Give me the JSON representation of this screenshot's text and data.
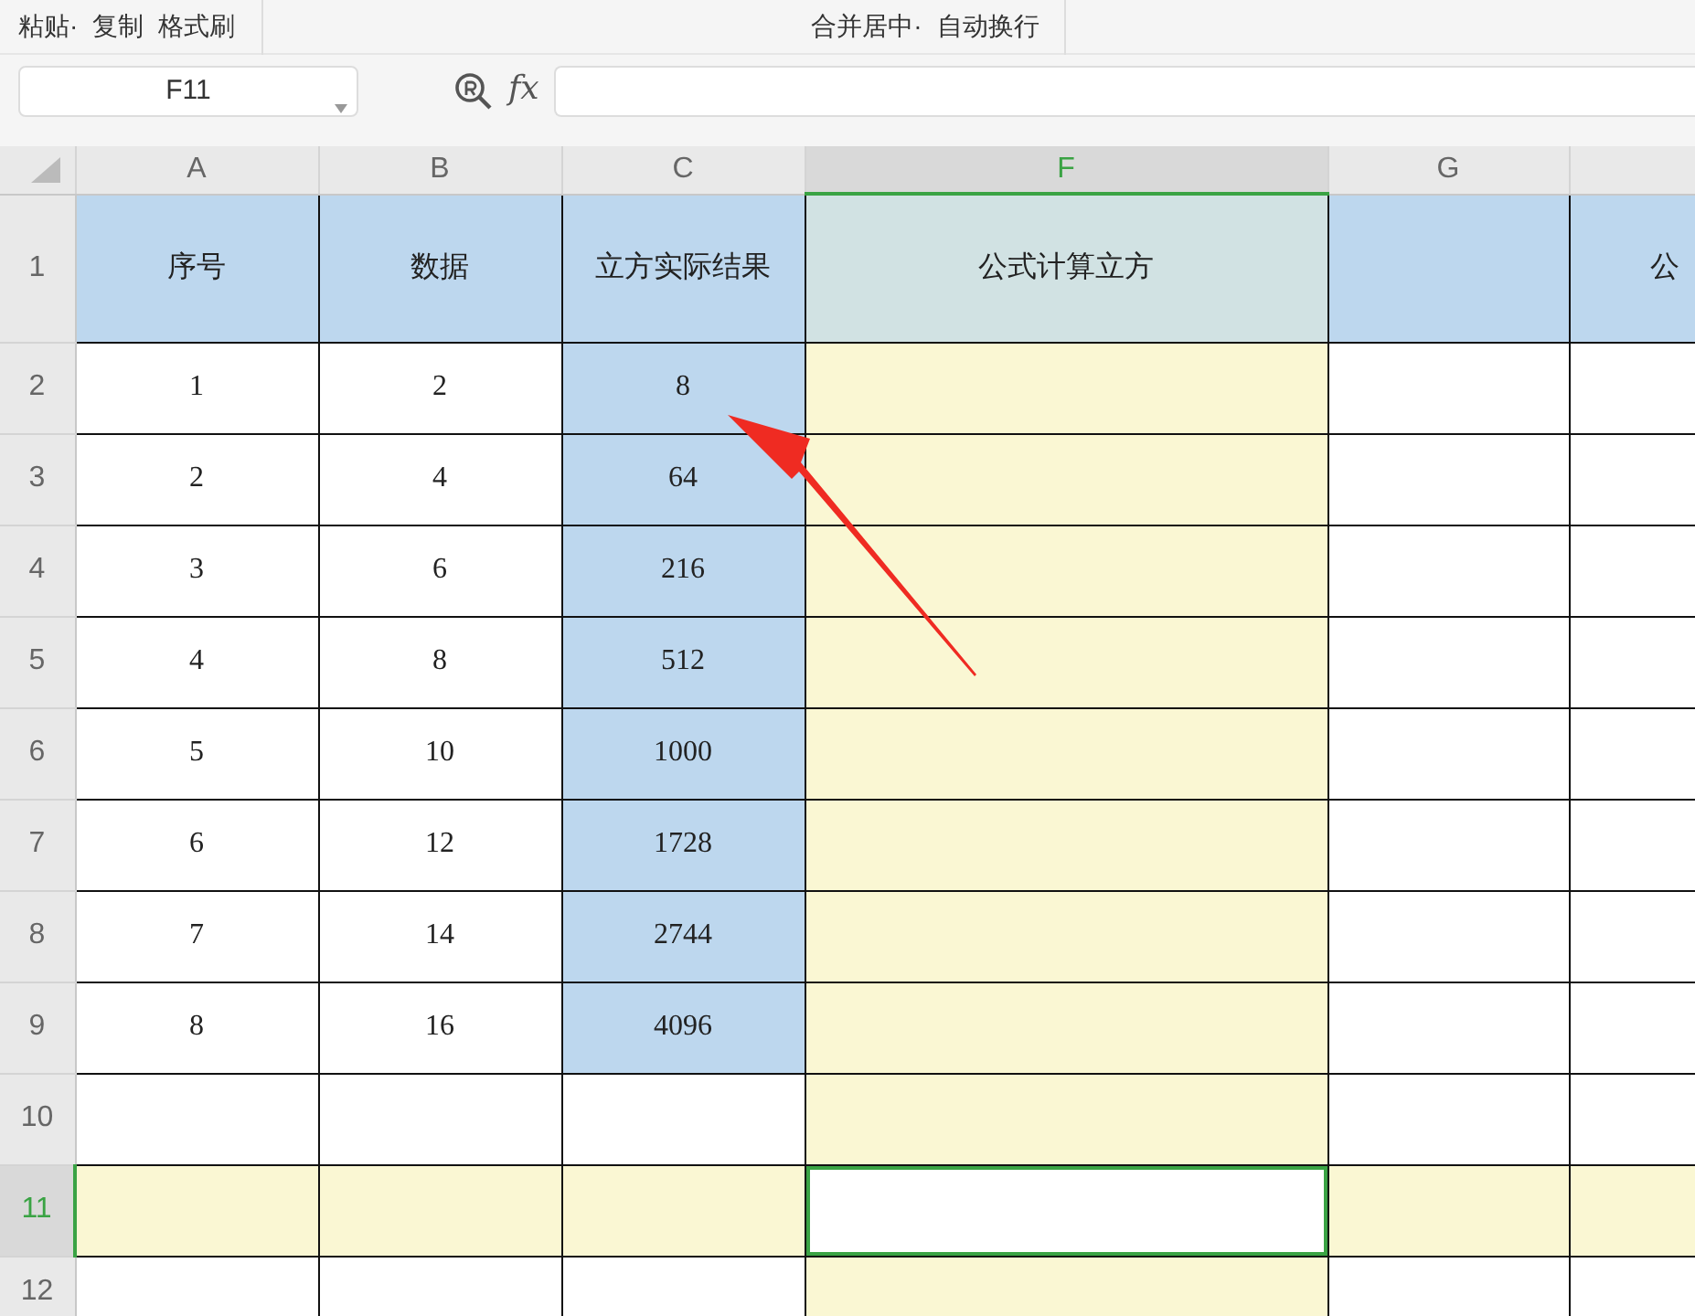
{
  "toolbar": {
    "groups": [
      [
        "粘贴·",
        "复制",
        "格式刷"
      ],
      [
        "合并居中·",
        "自动换行"
      ]
    ]
  },
  "formula_bar": {
    "name_box": "F11",
    "fx_label": "fx"
  },
  "columns": [
    {
      "label": "A",
      "selected": false
    },
    {
      "label": "B",
      "selected": false
    },
    {
      "label": "C",
      "selected": false
    },
    {
      "label": "F",
      "selected": true
    },
    {
      "label": "G",
      "selected": false
    },
    {
      "selected": false
    }
  ],
  "rows": [
    {
      "number": "1",
      "selected": false,
      "cells": [
        "序号",
        "数据",
        "立方实际结果",
        "公式计算立方",
        null,
        "公"
      ],
      "filled": [
        true,
        true,
        true,
        true,
        true,
        true
      ]
    },
    {
      "number": "2",
      "selected": false,
      "cells": [
        "1",
        "2",
        "8",
        null,
        null,
        null
      ],
      "filled": [
        false,
        false,
        true,
        false,
        false,
        false
      ]
    },
    {
      "number": "3",
      "selected": false,
      "cells": [
        "2",
        "4",
        "64",
        null,
        null,
        null
      ],
      "filled": [
        false,
        false,
        true,
        false,
        false,
        false
      ]
    },
    {
      "number": "4",
      "selected": false,
      "cells": [
        "3",
        "6",
        "216",
        null,
        null,
        null
      ],
      "filled": [
        false,
        false,
        true,
        false,
        false,
        false
      ]
    },
    {
      "number": "5",
      "selected": false,
      "cells": [
        "4",
        "8",
        "512",
        null,
        null,
        null
      ],
      "filled": [
        false,
        false,
        true,
        false,
        false,
        false
      ]
    },
    {
      "number": "6",
      "selected": false,
      "cells": [
        "5",
        "10",
        "1000",
        null,
        null,
        null
      ],
      "filled": [
        false,
        false,
        true,
        false,
        false,
        false
      ]
    },
    {
      "number": "7",
      "selected": false,
      "cells": [
        "6",
        "12",
        "1728",
        null,
        null,
        null
      ],
      "filled": [
        false,
        false,
        true,
        false,
        false,
        false
      ]
    },
    {
      "number": "8",
      "selected": false,
      "cells": [
        "7",
        "14",
        "2744",
        null,
        null,
        null
      ],
      "filled": [
        false,
        false,
        true,
        false,
        false,
        false
      ]
    },
    {
      "number": "9",
      "selected": false,
      "cells": [
        "8",
        "16",
        "4096",
        null,
        null,
        null
      ],
      "filled": [
        false,
        false,
        true,
        false,
        false,
        false
      ]
    },
    {
      "number": "10",
      "selected": false,
      "cells": [
        null,
        null,
        null,
        null,
        null,
        null
      ],
      "filled": [
        false,
        false,
        false,
        false,
        false,
        false
      ]
    },
    {
      "number": "11",
      "selected": true,
      "cells": [
        null,
        null,
        null,
        null,
        null,
        null
      ],
      "filled": [
        false,
        false,
        false,
        false,
        false,
        false
      ]
    },
    {
      "number": "12",
      "selected": false,
      "cells": [
        null,
        null,
        null,
        null,
        null,
        null
      ],
      "filled": [
        false,
        false,
        false,
        false,
        false,
        false
      ]
    }
  ]
}
